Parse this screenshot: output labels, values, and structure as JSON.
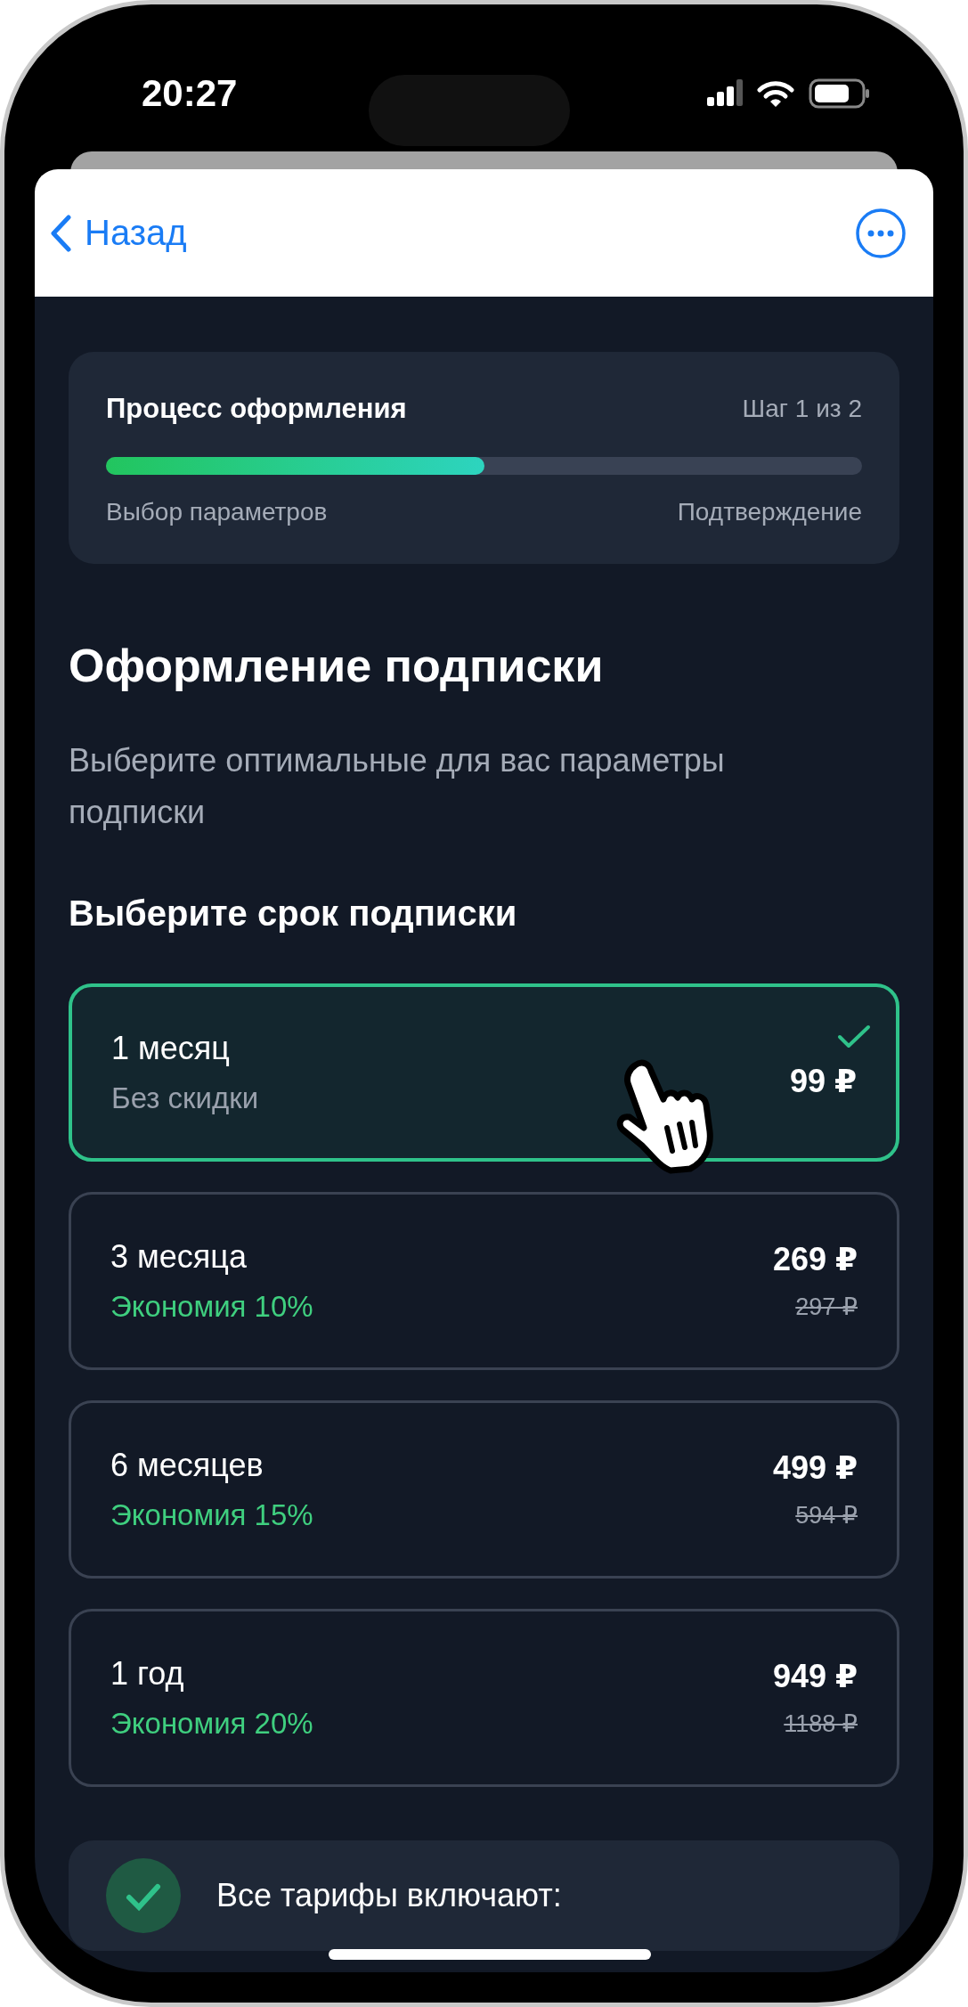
{
  "status_bar": {
    "time": "20:27"
  },
  "nav": {
    "back_label": "Назад"
  },
  "progress": {
    "title": "Процесс оформления",
    "step": "Шаг 1 из 2",
    "level": 0.5,
    "start_label": "Выбор параметров",
    "end_label": "Подтверждение"
  },
  "heading": "Оформление подписки",
  "subtitle": "Выберите оптимальные для вас параметры подписки",
  "section_title": "Выберите срок подписки",
  "options": [
    {
      "term": "1 месяц",
      "note": "Без скидки",
      "kind": "plain",
      "price": "99 ₽",
      "selected": true
    },
    {
      "term": "3 месяца",
      "note": "Экономия 10%",
      "kind": "discount",
      "price": "269 ₽",
      "old_price": "297 ₽",
      "selected": false
    },
    {
      "term": "6 месяцев",
      "note": "Экономия 15%",
      "kind": "discount",
      "price": "499 ₽",
      "old_price": "594 ₽",
      "selected": false
    },
    {
      "term": "1 год",
      "note": "Экономия 20%",
      "kind": "discount",
      "price": "949 ₽",
      "old_price": "1188 ₽",
      "selected": false
    }
  ],
  "features": {
    "title": "Все тарифы включают:"
  }
}
